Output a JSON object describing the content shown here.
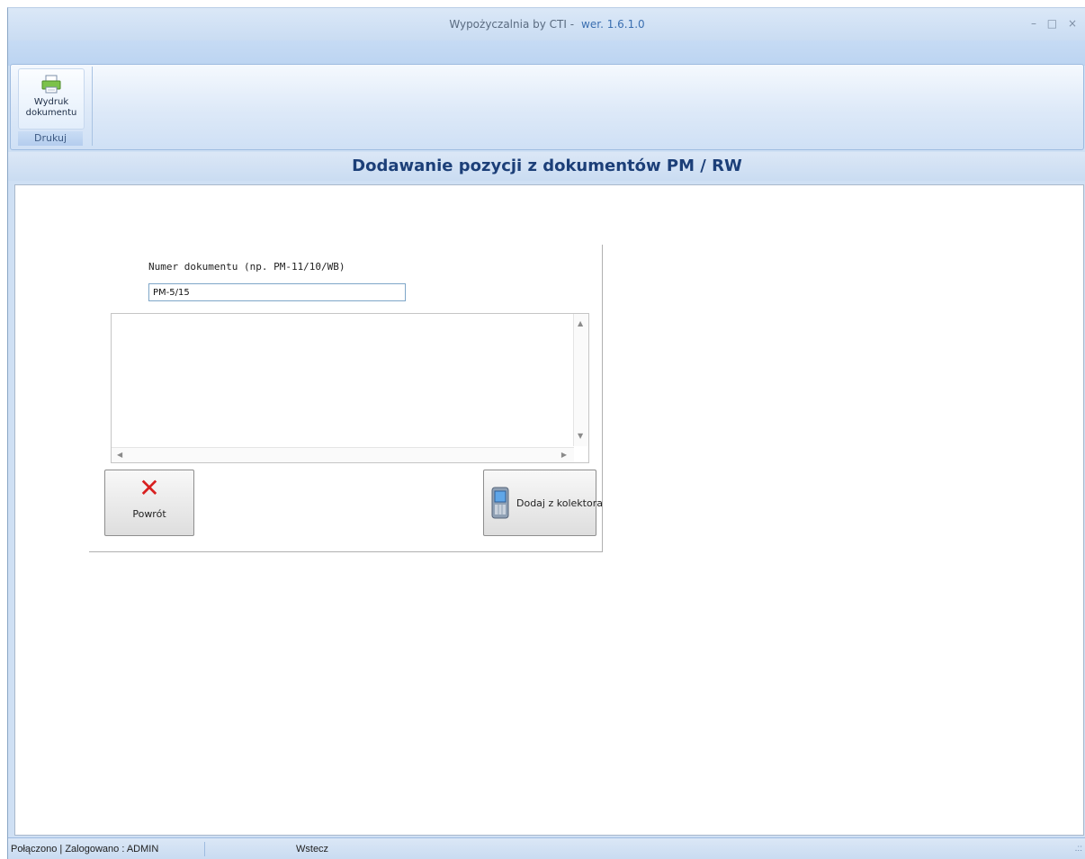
{
  "window": {
    "title": "Wypożyczalnia by CTI -",
    "version": "wer. 1.6.1.0",
    "controls": {
      "minimize": "–",
      "maximize": "□",
      "close": "×"
    }
  },
  "ribbon": {
    "print_button_label": "Wydruk dokumentu",
    "print_icon": "printer-icon",
    "group_label": "Drukuj"
  },
  "heading": {
    "title": "Dodawanie pozycji z dokumentów PM / RW"
  },
  "form": {
    "doc_number_label": "Numer dokumentu (np. PM-11/10/WB)",
    "doc_number_value": "PM-5/15",
    "back_button_label": "Powrót",
    "back_icon": "close-x-icon",
    "add_button_label": "Dodaj z kolektora",
    "add_icon": "mobile-device-icon"
  },
  "statusbar": {
    "connection": "Połączono | Zalogowano : ADMIN",
    "back": "Wstecz"
  },
  "colors": {
    "heading": "#1c3f78",
    "accent": "#3b6fb0",
    "x_icon": "#d81f1f"
  }
}
